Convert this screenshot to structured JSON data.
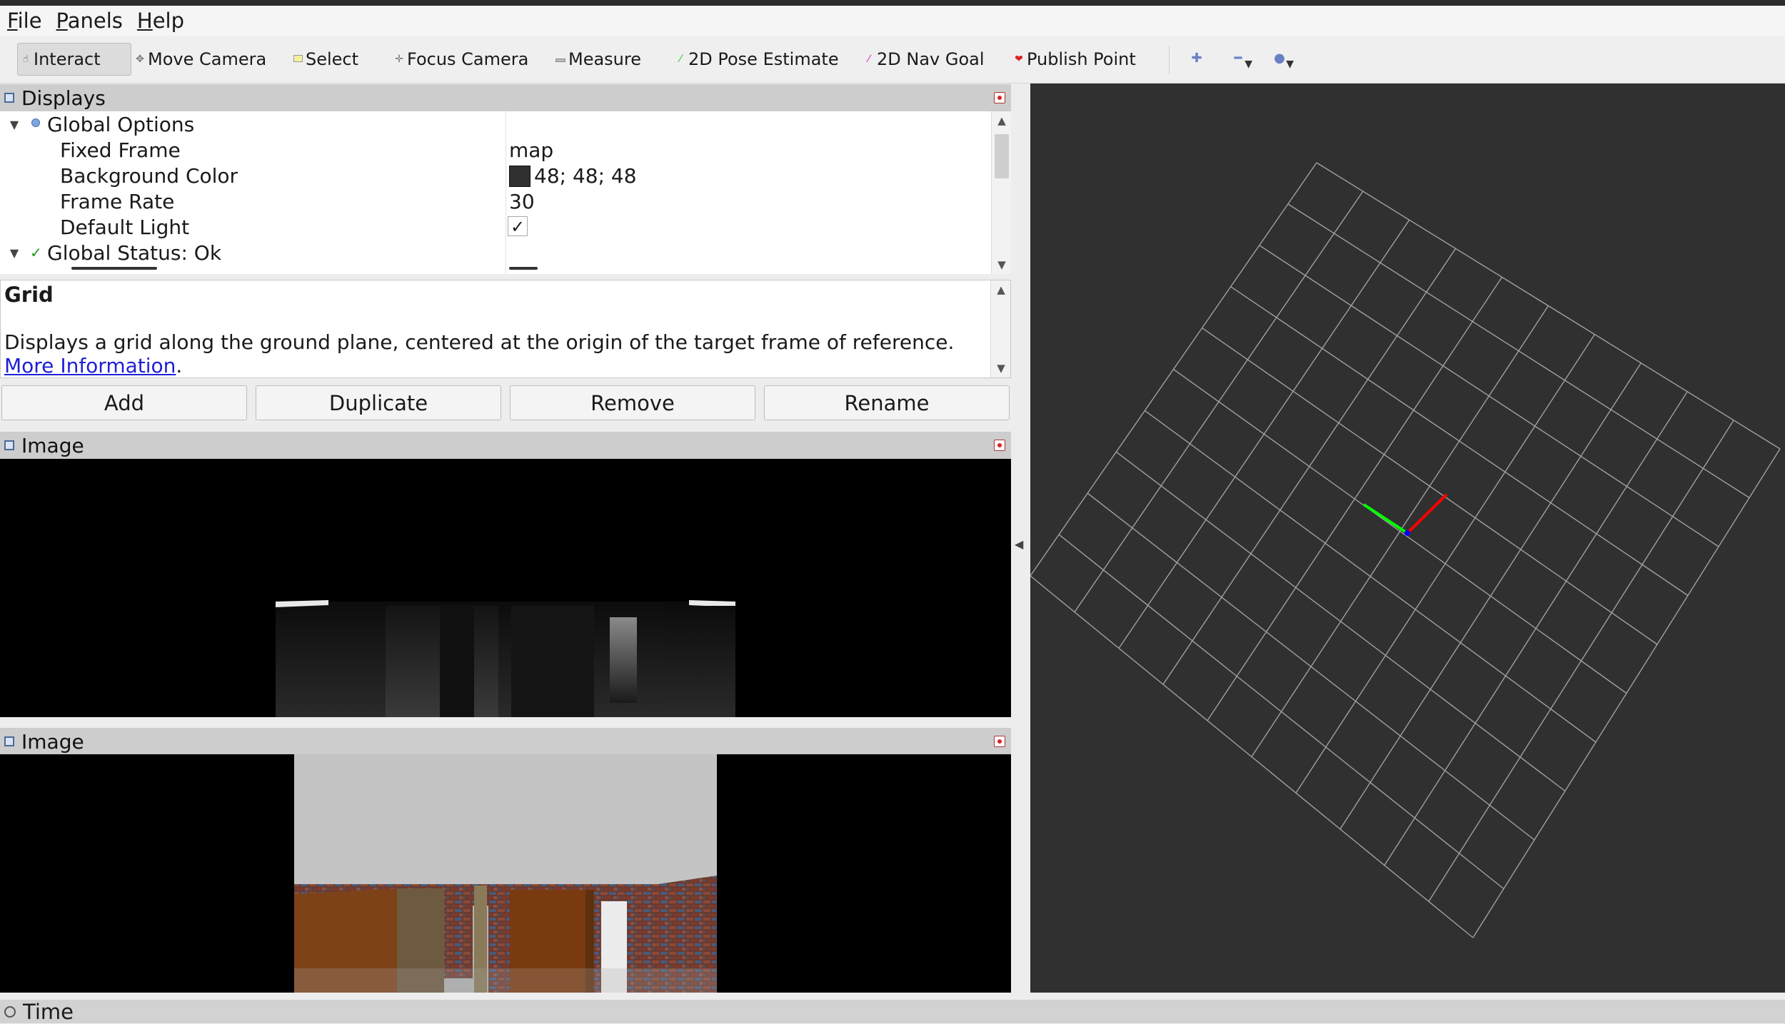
{
  "menubar": {
    "items": [
      {
        "accel": "F",
        "rest": "ile"
      },
      {
        "accel": "P",
        "rest": "anels"
      },
      {
        "accel": "H",
        "rest": "elp"
      }
    ]
  },
  "toolbar": {
    "tools": [
      {
        "label": "Interact",
        "icon": "hand-pointer-icon",
        "active": true
      },
      {
        "label": "Move Camera",
        "icon": "move-arrows-icon"
      },
      {
        "label": "Select",
        "icon": "select-rect-icon"
      },
      {
        "label": "Focus Camera",
        "icon": "focus-target-icon"
      },
      {
        "label": "Measure",
        "icon": "ruler-icon"
      },
      {
        "label": "2D Pose Estimate",
        "icon": "green-arrow-icon"
      },
      {
        "label": "2D Nav Goal",
        "icon": "pink-arrow-icon"
      },
      {
        "label": "Publish Point",
        "icon": "pin-icon"
      }
    ],
    "view_buttons": [
      {
        "icon": "plus-icon",
        "has_dropdown": false
      },
      {
        "icon": "minus-icon",
        "has_dropdown": true
      },
      {
        "icon": "eye-icon",
        "has_dropdown": true
      }
    ]
  },
  "displays_panel": {
    "title": "Displays",
    "rows": [
      {
        "label": "Global Options",
        "value": "",
        "expanded": true,
        "icon": "globe-icon"
      },
      {
        "label": "Fixed Frame",
        "value": "map"
      },
      {
        "label": "Background Color",
        "value": "48; 48; 48",
        "swatch": "#303030"
      },
      {
        "label": "Frame Rate",
        "value": "30"
      },
      {
        "label": "Default Light",
        "value": "✓",
        "checkbox": true
      },
      {
        "label": "Global Status: Ok",
        "value": "",
        "expanded": true,
        "icon": "check-icon"
      }
    ],
    "description": {
      "title": "Grid",
      "body": "Displays a grid along the ground plane, centered at the origin of the target frame of reference. ",
      "link": "More Information",
      "tail": "."
    },
    "buttons": {
      "add": "Add",
      "duplicate": "Duplicate",
      "remove": "Remove",
      "rename": "Rename"
    }
  },
  "image_panel_1": {
    "title": "Image"
  },
  "image_panel_2": {
    "title": "Image"
  },
  "time_panel": {
    "title": "Time"
  },
  "colors": {
    "render_background": "#303030",
    "grid_line": "#a0a0a0",
    "axis_x": "#ff0000",
    "axis_y": "#00ff00",
    "axis_z": "#0000ff",
    "link": "#1f20d6"
  }
}
